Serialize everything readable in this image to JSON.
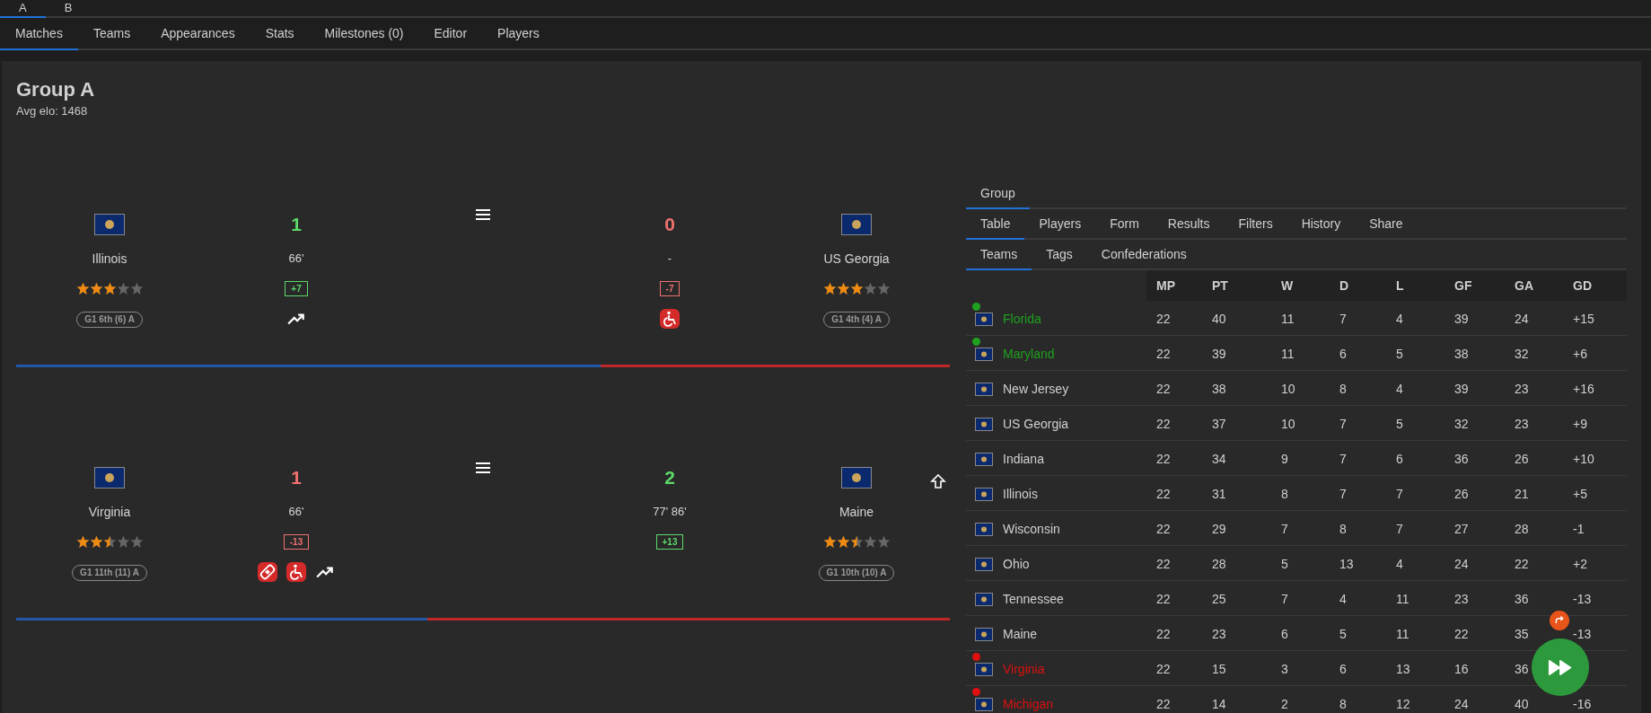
{
  "top_tabs": [
    {
      "label": "A",
      "selected": true
    },
    {
      "label": "B",
      "selected": false
    }
  ],
  "nav_tabs": [
    {
      "label": "Matches",
      "selected": true
    },
    {
      "label": "Teams",
      "selected": false
    },
    {
      "label": "Appearances",
      "selected": false
    },
    {
      "label": "Stats",
      "selected": false
    },
    {
      "label": "Milestones (0)",
      "selected": false
    },
    {
      "label": "Editor",
      "selected": false
    },
    {
      "label": "Players",
      "selected": false
    }
  ],
  "group": {
    "title": "Group A",
    "subtitle": "Avg elo: 1468"
  },
  "matches": [
    {
      "level": 0.626,
      "show_top_button": false,
      "home": {
        "name": "Illinois",
        "score": "1",
        "won": true,
        "minutes": "66'",
        "elo_change": "+7",
        "stars": 3,
        "rank": "G1 6th (6) A",
        "icons": [
          {
            "kind": "trend"
          }
        ]
      },
      "away": {
        "name": "US Georgia",
        "score": "0",
        "won": false,
        "minutes": "-",
        "elo_change": "-7",
        "stars": 3,
        "rank": "G1 4th (4) A",
        "icons": [
          {
            "kind": "wheelchair"
          }
        ]
      }
    },
    {
      "level": 0.44,
      "show_top_button": true,
      "home": {
        "name": "Virginia",
        "score": "1",
        "won": false,
        "minutes": "66'",
        "elo_change": "-13",
        "stars": 2.5,
        "rank": "G1 11th (11) A",
        "icons": [
          {
            "kind": "bandage"
          },
          {
            "kind": "wheelchair"
          },
          {
            "kind": "trend"
          }
        ]
      },
      "away": {
        "name": "Maine",
        "score": "2",
        "won": true,
        "minutes": "77' 86'",
        "elo_change": "+13",
        "stars": 2.5,
        "rank": "G1 10th (10) A"
      }
    }
  ],
  "side_tabs": [
    {
      "label": "Group",
      "selected": true
    }
  ],
  "table_tabs": [
    {
      "label": "Table",
      "selected": true
    },
    {
      "label": "Players",
      "selected": false
    },
    {
      "label": "Form",
      "selected": false
    },
    {
      "label": "Results",
      "selected": false
    },
    {
      "label": "Filters",
      "selected": false
    },
    {
      "label": "History",
      "selected": false
    },
    {
      "label": "Share",
      "selected": false
    }
  ],
  "sub_tabs": [
    {
      "label": "Teams",
      "selected": true
    },
    {
      "label": "Tags",
      "selected": false
    },
    {
      "label": "Confederations",
      "selected": false
    }
  ],
  "table": {
    "columns": [
      "MP",
      "PT",
      "W",
      "D",
      "L",
      "GF",
      "GA",
      "GD"
    ],
    "rows": [
      {
        "team": "Florida",
        "color": "#1fa01f",
        "cells": [
          "22",
          "40",
          "11",
          "7",
          "4",
          "39",
          "24",
          "+15"
        ]
      },
      {
        "team": "Maryland",
        "color": "#1fa01f",
        "cells": [
          "22",
          "39",
          "11",
          "6",
          "5",
          "38",
          "32",
          "+6"
        ]
      },
      {
        "team": "New Jersey",
        "cells": [
          "22",
          "38",
          "10",
          "8",
          "4",
          "39",
          "23",
          "+16"
        ]
      },
      {
        "team": "US Georgia",
        "cells": [
          "22",
          "37",
          "10",
          "7",
          "5",
          "32",
          "23",
          "+9"
        ]
      },
      {
        "team": "Indiana",
        "cells": [
          "22",
          "34",
          "9",
          "7",
          "6",
          "36",
          "26",
          "+10"
        ]
      },
      {
        "team": "Illinois",
        "cells": [
          "22",
          "31",
          "8",
          "7",
          "7",
          "26",
          "21",
          "+5"
        ]
      },
      {
        "team": "Wisconsin",
        "cells": [
          "22",
          "29",
          "7",
          "8",
          "7",
          "27",
          "28",
          "-1"
        ]
      },
      {
        "team": "Ohio",
        "cells": [
          "22",
          "28",
          "5",
          "13",
          "4",
          "24",
          "22",
          "+2"
        ]
      },
      {
        "team": "Tennessee",
        "cells": [
          "22",
          "25",
          "7",
          "4",
          "11",
          "23",
          "36",
          "-13"
        ]
      },
      {
        "team": "Maine",
        "cells": [
          "22",
          "23",
          "6",
          "5",
          "11",
          "22",
          "35",
          "-13"
        ]
      },
      {
        "team": "Virginia",
        "color": "#e01010",
        "cells": [
          "22",
          "15",
          "3",
          "6",
          "13",
          "16",
          "36",
          null
        ]
      },
      {
        "team": "Michigan",
        "color": "#e01010",
        "cells": [
          "22",
          "14",
          "2",
          "8",
          "12",
          "24",
          "40",
          "-16"
        ]
      }
    ]
  }
}
